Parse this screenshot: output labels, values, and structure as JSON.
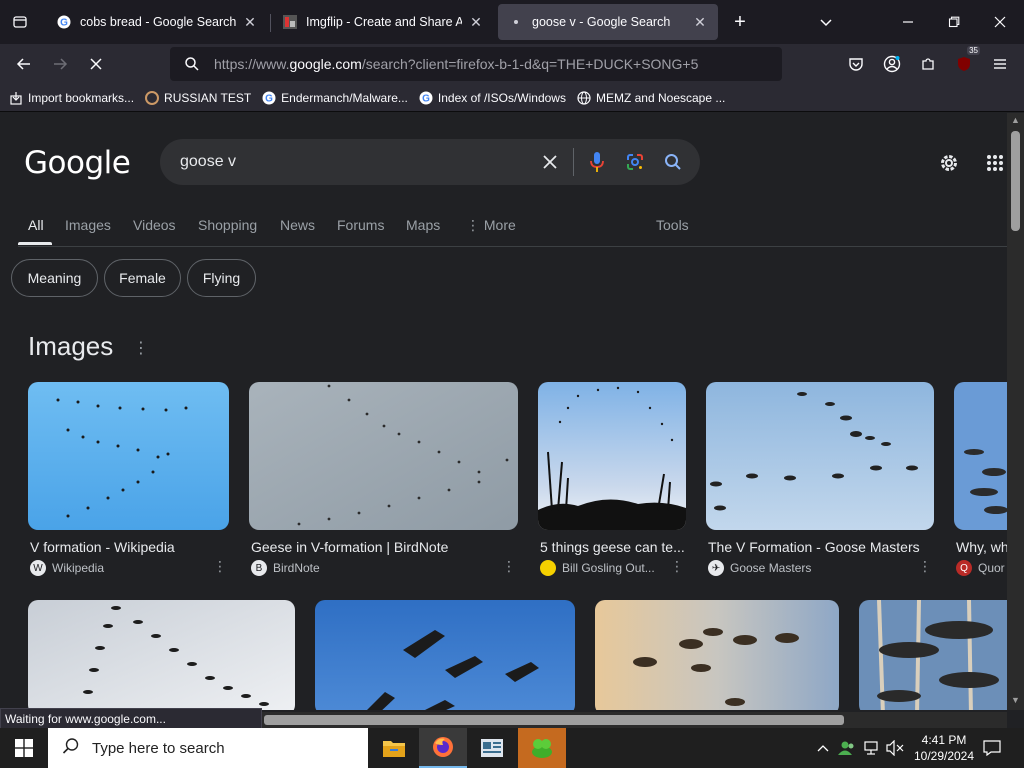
{
  "browser": {
    "tabs": [
      {
        "title": "cobs bread - Google Search",
        "active": false
      },
      {
        "title": "Imgflip - Create and Share Awe",
        "active": false
      },
      {
        "title": "goose v - Google Search",
        "active": true
      }
    ],
    "url_prefix": "https://www.",
    "url_domain": "google.com",
    "url_rest": "/search?client=firefox-b-1-d&q=THE+DUCK+SONG+5",
    "extensions_badge": "35",
    "bookmarks": [
      {
        "label": "Import bookmarks...",
        "icon": "import-icon"
      },
      {
        "label": "RUSSIAN TEST",
        "icon": "github-icon"
      },
      {
        "label": "Endermanch/Malware...",
        "icon": "google-icon"
      },
      {
        "label": "Index of /ISOs/Windows",
        "icon": "google-icon"
      },
      {
        "label": "MEMZ and Noescape ...",
        "icon": "globe-icon"
      }
    ],
    "status_text": "Waiting for www.google.com..."
  },
  "google": {
    "logo": "Google",
    "query": "goose v",
    "tabs": [
      "All",
      "Images",
      "Videos",
      "Shopping",
      "News",
      "Forums",
      "Maps",
      "More"
    ],
    "tools_label": "Tools",
    "chips": [
      "Meaning",
      "Female",
      "Flying"
    ],
    "images_title": "Images",
    "images": [
      {
        "title": "V formation - Wikipedia",
        "source": "Wikipedia"
      },
      {
        "title": "Geese in V-formation | BirdNote",
        "source": "BirdNote"
      },
      {
        "title": "5 things geese can te...",
        "source": "Bill Gosling Out..."
      },
      {
        "title": "The V Formation - Goose Masters",
        "source": "Goose Masters"
      },
      {
        "title": "Why, wh",
        "source": "Quor"
      }
    ]
  },
  "taskbar": {
    "search_placeholder": "Type here to search",
    "time": "4:41 PM",
    "date": "10/29/2024"
  },
  "colors": {
    "page_bg": "#202124",
    "chrome_bg": "#2b2a33",
    "google_blue": "#4285f4",
    "google_red": "#ea4335",
    "google_yellow": "#fbbc05",
    "google_green": "#34a853"
  }
}
